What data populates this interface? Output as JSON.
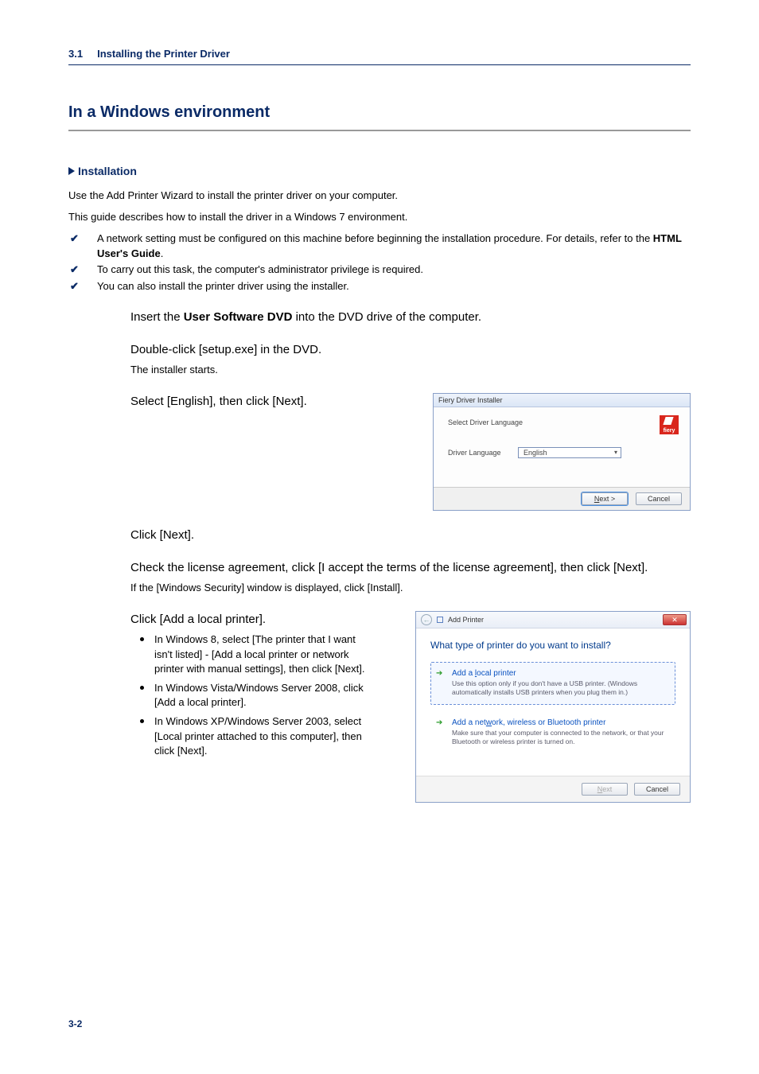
{
  "header": {
    "section_num": "3.1",
    "section_title": "Installing the Printer Driver"
  },
  "h2": "In a Windows environment",
  "h3": "Installation",
  "intro1": "Use the Add Printer Wizard to install the printer driver on your computer.",
  "intro2": "This guide describes how to install the driver in a Windows 7 environment.",
  "checks": {
    "c1a": "A network setting must be configured on this machine before beginning the installation procedure. For details, refer to the ",
    "c1b": "HTML User's Guide",
    "c1c": ".",
    "c2": "To carry out this task, the computer's administrator privilege is required.",
    "c3": "You can also install the printer driver using the installer."
  },
  "steps": {
    "s1a": "Insert the ",
    "s1b": "User Software DVD",
    "s1c": " into the DVD drive of the computer.",
    "s2": "Double-click [setup.exe] in the DVD.",
    "s2sub": "The installer starts.",
    "s3": "Select [English], then click [Next].",
    "s4": "Click [Next].",
    "s5": "Check the license agreement, click [I accept the terms of the license agreement], then click [Next].",
    "s5sub": "If the [Windows Security] window is displayed, click [Install].",
    "s6": "Click [Add a local printer].",
    "s6b1": "In Windows 8, select [The printer that I want isn't listed] - [Add a local printer or network printer with manual settings], then click [Next].",
    "s6b2": "In Windows Vista/Windows Server 2008, click [Add a local printer].",
    "s6b3": "In Windows XP/Windows Server 2003, select [Local printer attached to this computer], then click [Next]."
  },
  "shot1": {
    "title": "Fiery Driver Installer",
    "heading": "Select Driver Language",
    "label": "Driver Language",
    "value": "English",
    "logo": "fiery",
    "next_u": "N",
    "next_rest": "ext >",
    "cancel": "Cancel"
  },
  "shot2": {
    "title": "Add Printer",
    "question": "What type of printer do you want to install?",
    "opt1": {
      "t_pre": "Add a ",
      "t_u": "l",
      "t_post": "ocal printer",
      "d": "Use this option only if you don't have a USB printer. (Windows automatically installs USB printers when you plug them in.)"
    },
    "opt2": {
      "t_pre": "Add a net",
      "t_u": "w",
      "t_post": "ork, wireless or Bluetooth printer",
      "d": "Make sure that your computer is connected to the network, or that your Bluetooth or wireless printer is turned on."
    },
    "next_u": "N",
    "next_rest": "ext",
    "cancel": "Cancel"
  },
  "footer": "3-2"
}
